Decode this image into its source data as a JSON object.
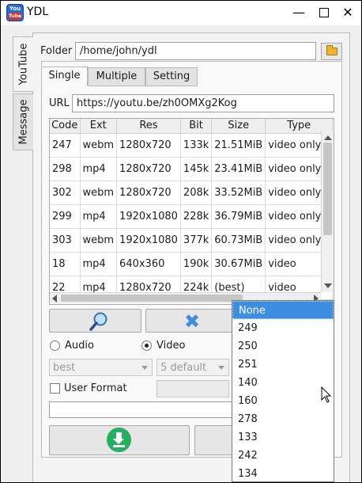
{
  "window": {
    "title": "YDL",
    "icon_text_top": "You",
    "icon_text_bottom": "Tube"
  },
  "side_tabs": [
    {
      "label": "YouTube"
    },
    {
      "label": "Message"
    }
  ],
  "folder": {
    "label": "Folder",
    "value": "/home/john/ydl"
  },
  "tabs": [
    {
      "label": "Single"
    },
    {
      "label": "Multiple"
    },
    {
      "label": "Setting"
    }
  ],
  "url": {
    "label": "URL",
    "value": "https://youtu.be/zh0OMXg2Kog"
  },
  "table": {
    "columns": [
      "Code",
      "Ext",
      "Res",
      "Bit",
      "Size",
      "Type"
    ],
    "rows": [
      [
        "247",
        "webm",
        "1280x720",
        "133k",
        "21.51MiB",
        "video only"
      ],
      [
        "298",
        "mp4",
        "1280x720",
        "145k",
        "23.41MiB",
        "video only"
      ],
      [
        "302",
        "webm",
        "1280x720",
        "208k",
        "33.52MiB",
        "video only"
      ],
      [
        "299",
        "mp4",
        "1920x1080",
        "228k",
        "36.79MiB",
        "video only"
      ],
      [
        "303",
        "webm",
        "1920x1080",
        "377k",
        "60.73MiB",
        "video only"
      ],
      [
        "18",
        "mp4",
        "640x360",
        "190k",
        "30.67MiB",
        "video"
      ],
      [
        "22",
        "mp4",
        "1280x720",
        "224k",
        "(best)",
        "video"
      ]
    ]
  },
  "options": {
    "audio_label": "Audio",
    "video_label": "Video",
    "selected": "video",
    "quality_combo": "best",
    "default_combo": "5 default",
    "user_format_label": "User Format"
  },
  "dropdown": {
    "options": [
      "None",
      "249",
      "250",
      "251",
      "140",
      "160",
      "278",
      "133",
      "242",
      "134"
    ],
    "selected_index": 0
  },
  "colors": {
    "accent": "#3d8ee0",
    "download": "#27ae60",
    "close_icon": "#3f8ed8"
  }
}
